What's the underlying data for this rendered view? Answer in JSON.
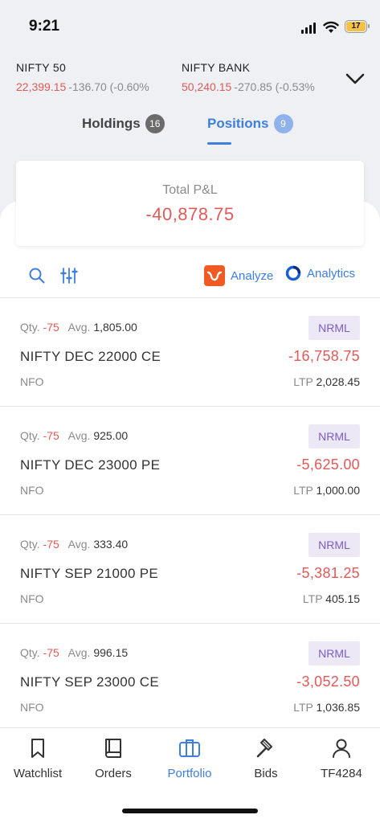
{
  "status": {
    "time": "9:21",
    "battery": "17"
  },
  "indices": [
    {
      "name": "NIFTY 50",
      "price": "22,399.15",
      "change": "-136.70 (-0.60%"
    },
    {
      "name": "NIFTY BANK",
      "price": "50,240.15",
      "change": "-270.85 (-0.53%"
    }
  ],
  "tabs": {
    "holdings": {
      "label": "Holdings",
      "count": "16"
    },
    "positions": {
      "label": "Positions",
      "count": "9"
    }
  },
  "summary": {
    "label": "Total P&L",
    "value": "-40,878.75"
  },
  "toolbar": {
    "analyze": "Analyze",
    "analytics": "Analytics"
  },
  "positions": [
    {
      "qty_label": "Qty.",
      "qty": "-75",
      "avg_label": "Avg.",
      "avg": "1,805.00",
      "product": "NRML",
      "symbol": "NIFTY DEC 22000 CE",
      "pnl": "-16,758.75",
      "exchange": "NFO",
      "ltp_label": "LTP",
      "ltp": "2,028.45"
    },
    {
      "qty_label": "Qty.",
      "qty": "-75",
      "avg_label": "Avg.",
      "avg": "925.00",
      "product": "NRML",
      "symbol": "NIFTY DEC 23000 PE",
      "pnl": "-5,625.00",
      "exchange": "NFO",
      "ltp_label": "LTP",
      "ltp": "1,000.00"
    },
    {
      "qty_label": "Qty.",
      "qty": "-75",
      "avg_label": "Avg.",
      "avg": "333.40",
      "product": "NRML",
      "symbol": "NIFTY SEP 21000 PE",
      "pnl": "-5,381.25",
      "exchange": "NFO",
      "ltp_label": "LTP",
      "ltp": "405.15"
    },
    {
      "qty_label": "Qty.",
      "qty": "-75",
      "avg_label": "Avg.",
      "avg": "996.15",
      "product": "NRML",
      "symbol": "NIFTY SEP 23000 CE",
      "pnl": "-3,052.50",
      "exchange": "NFO",
      "ltp_label": "LTP",
      "ltp": "1,036.85"
    }
  ],
  "nav": {
    "watchlist": "Watchlist",
    "orders": "Orders",
    "portfolio": "Portfolio",
    "bids": "Bids",
    "account": "TF4284"
  },
  "colors": {
    "accent": "#3d7ee0",
    "loss": "#e25a57",
    "product_bg": "#ece8f6",
    "product_text": "#7d5bc4",
    "analyze_brand": "#f25a23"
  },
  "icons": [
    "signal-icon",
    "wifi-icon",
    "battery-icon",
    "chevron-down-icon",
    "search-icon",
    "filter-sliders-icon",
    "analyze-logo-icon",
    "analytics-logo-icon",
    "bookmark-icon",
    "book-icon",
    "briefcase-icon",
    "gavel-icon",
    "user-icon"
  ]
}
